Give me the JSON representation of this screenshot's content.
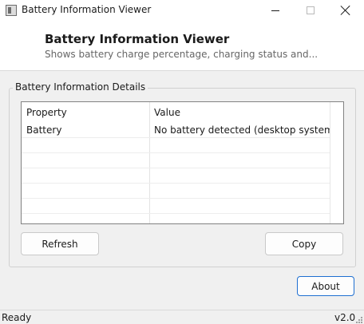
{
  "window": {
    "title": "Battery Information Viewer",
    "controls": {
      "minimize_icon": "minimize-icon",
      "maximize_icon": "maximize-icon",
      "close_icon": "close-icon"
    }
  },
  "header": {
    "title": "Battery Information Viewer",
    "subtitle": "Shows battery charge percentage, charging status and..."
  },
  "group": {
    "title": "Battery Information Details"
  },
  "table": {
    "columns": [
      "Property",
      "Value"
    ],
    "rows": [
      {
        "property": "Battery",
        "value": "No battery detected (desktop system)"
      }
    ]
  },
  "buttons": {
    "refresh": "Refresh",
    "copy": "Copy",
    "about": "About"
  },
  "status": {
    "text": "Ready",
    "version": "v2.0"
  },
  "colors": {
    "accent": "#1e6fd1",
    "background": "#f0f0f0",
    "panel": "#ffffff"
  }
}
